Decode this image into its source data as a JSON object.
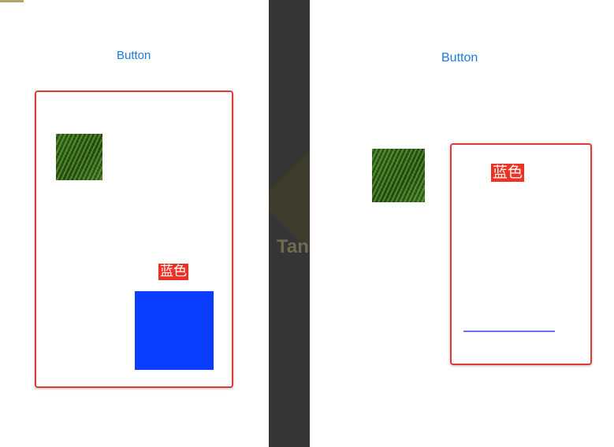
{
  "left_screen": {
    "button_label": "Button",
    "label_text": "蓝色",
    "square_color": "#0b3dff"
  },
  "right_screen": {
    "button_label": "Button",
    "label_text": "蓝色",
    "line_color": "#6d6dff"
  },
  "colors": {
    "frame_border": "#e13a35",
    "label_background": "#ee3124",
    "link_blue": "#1c7ae0"
  },
  "watermark": {
    "text": "Tan"
  }
}
